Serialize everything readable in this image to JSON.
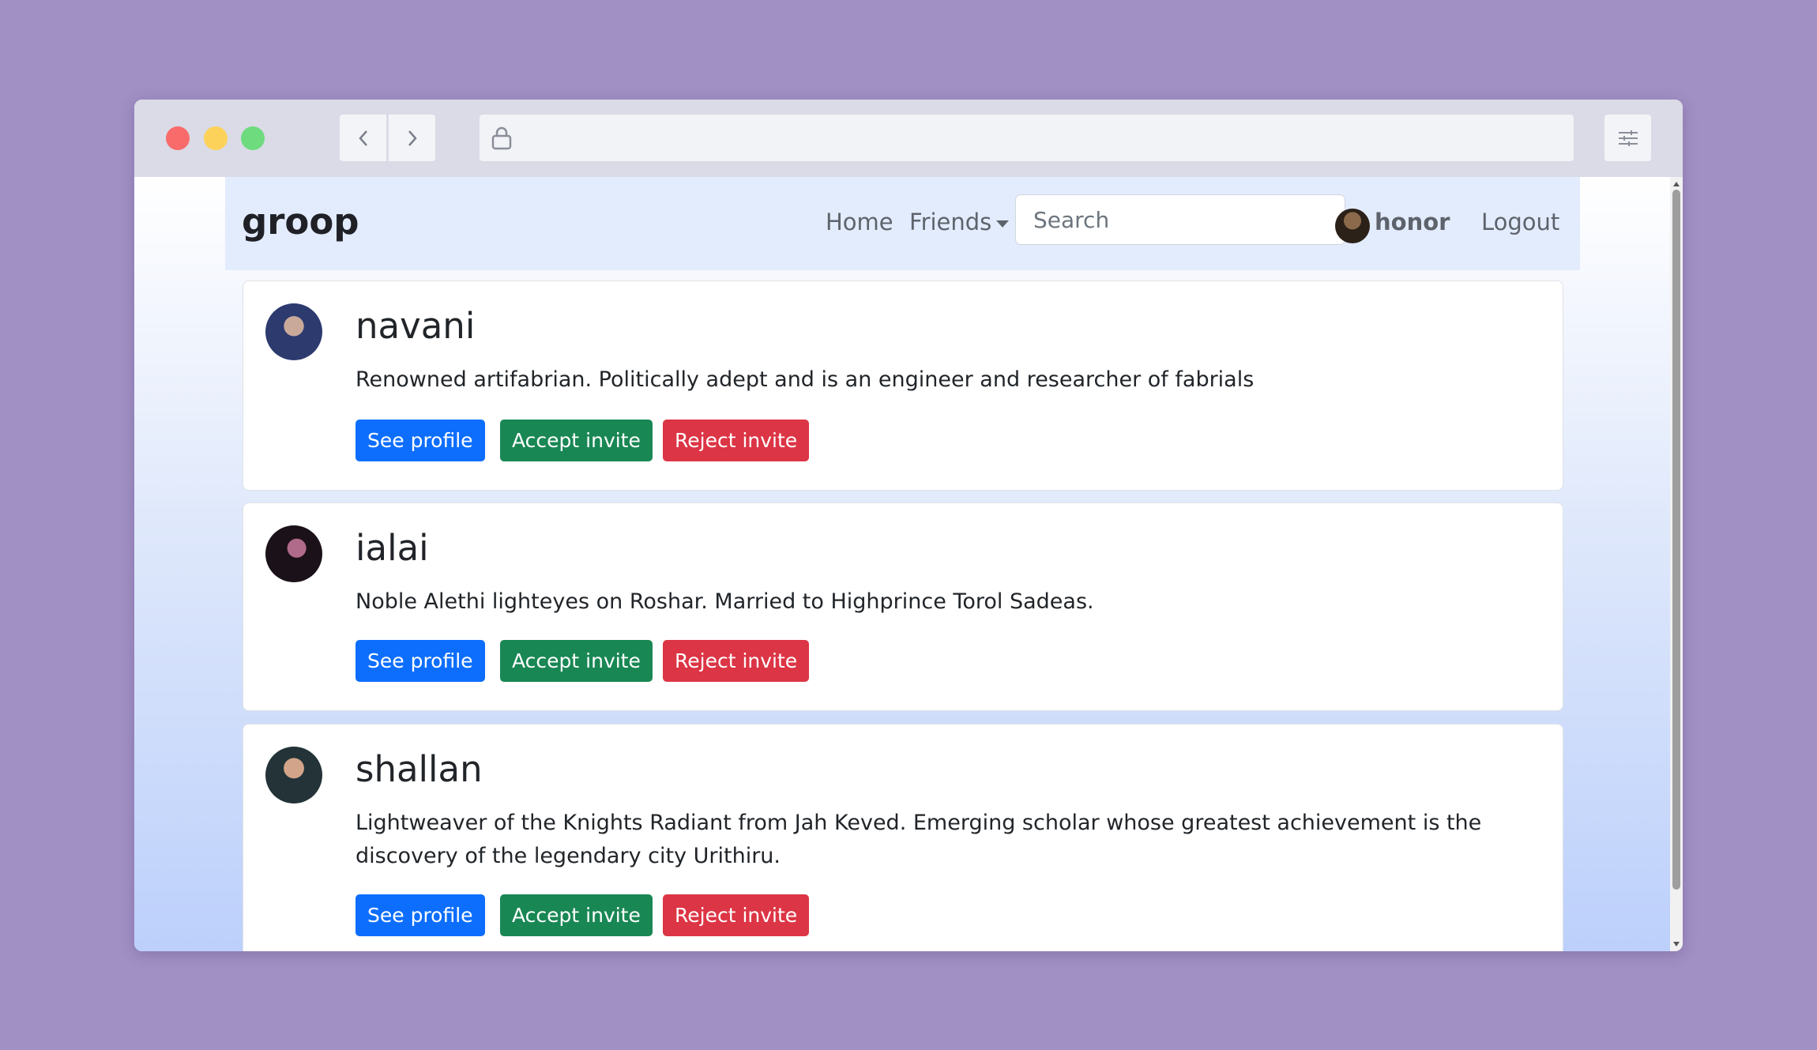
{
  "browser": {
    "url": ""
  },
  "app": {
    "brand": "groop",
    "nav": {
      "home": "Home",
      "friends": "Friends",
      "search_placeholder": "Search",
      "username": "honor",
      "logout": "Logout"
    }
  },
  "invites": [
    {
      "name": "navani",
      "bio": "Renowned artifabrian. Politically adept and is an engineer and researcher of fabrials",
      "see_profile": "See profile",
      "accept": "Accept invite",
      "reject": "Reject invite"
    },
    {
      "name": "ialai",
      "bio": "Noble Alethi lighteyes on Roshar. Married to Highprince Torol Sadeas.",
      "see_profile": "See profile",
      "accept": "Accept invite",
      "reject": "Reject invite"
    },
    {
      "name": "shallan",
      "bio": "Lightweaver of the Knights Radiant from Jah Keved. Emerging scholar whose greatest achievement is the discovery of the legendary city Urithiru.",
      "see_profile": "See profile",
      "accept": "Accept invite",
      "reject": "Reject invite"
    }
  ],
  "colors": {
    "primary": "#0d6efd",
    "success": "#198754",
    "danger": "#dc3545",
    "navbar": "#e2ecfd",
    "backdrop": "#a190c4"
  }
}
